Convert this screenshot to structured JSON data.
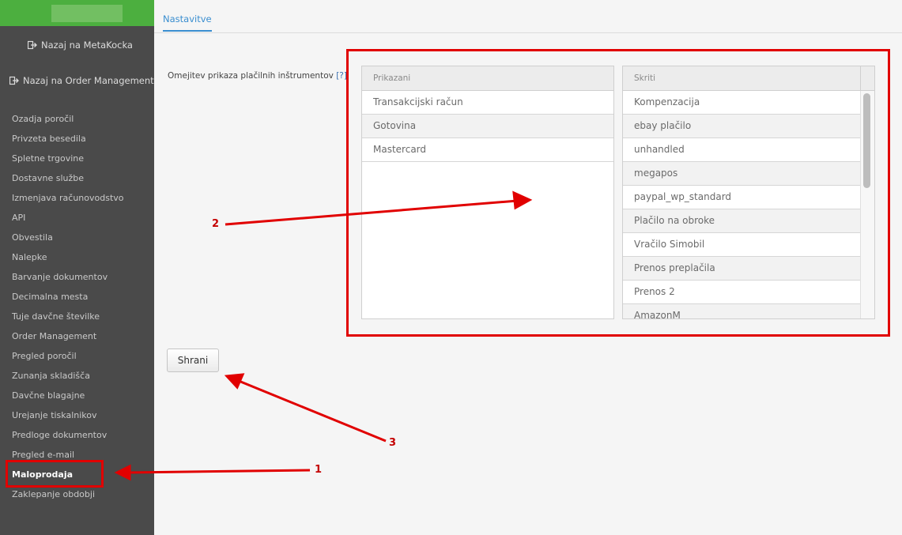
{
  "sidebar": {
    "back_links": [
      {
        "label": "Nazaj na MetaKocka",
        "icon": "sign-out-icon"
      },
      {
        "label": "Nazaj na Order Management",
        "icon": "sign-out-icon"
      }
    ],
    "items": [
      {
        "label": "Ozadja poročil"
      },
      {
        "label": "Privzeta besedila"
      },
      {
        "label": "Spletne trgovine"
      },
      {
        "label": "Dostavne službe"
      },
      {
        "label": "Izmenjava računovodstvo"
      },
      {
        "label": "API"
      },
      {
        "label": "Obvestila"
      },
      {
        "label": "Nalepke"
      },
      {
        "label": "Barvanje dokumentov"
      },
      {
        "label": "Decimalna mesta"
      },
      {
        "label": "Tuje davčne številke"
      },
      {
        "label": "Order Management"
      },
      {
        "label": "Pregled poročil"
      },
      {
        "label": "Zunanja skladišča"
      },
      {
        "label": "Davčne blagajne"
      },
      {
        "label": "Urejanje tiskalnikov"
      },
      {
        "label": "Predloge dokumentov"
      },
      {
        "label": "Pregled e-mail"
      },
      {
        "label": "Maloprodaja",
        "active": true
      },
      {
        "label": "Zaklepanje obdobji"
      }
    ]
  },
  "tabs": [
    {
      "label": "Nastavitve",
      "active": true
    }
  ],
  "form": {
    "label": "Omejitev prikaza plačilnih inštrumentov",
    "help": "[?]",
    "save_label": "Shrani"
  },
  "lists": {
    "shown": {
      "header": "Prikazani",
      "items": [
        "Transakcijski račun",
        "Gotovina",
        "Mastercard"
      ]
    },
    "hidden": {
      "header": "Skriti",
      "items": [
        "Kompenzacija",
        "ebay plačilo",
        "unhandled",
        "megapos",
        "paypal_wp_standard",
        "Plačilo na obroke",
        "Vračilo Simobil",
        "Prenos preplačila",
        "Prenos 2",
        "AmazonM"
      ]
    }
  },
  "annotations": [
    "1",
    "2",
    "3"
  ],
  "colors": {
    "sidebar_bg": "#4a4a4a",
    "header_green": "#4caf3f",
    "accent_blue": "#3a8ed0",
    "annotation_red": "#e10000"
  }
}
